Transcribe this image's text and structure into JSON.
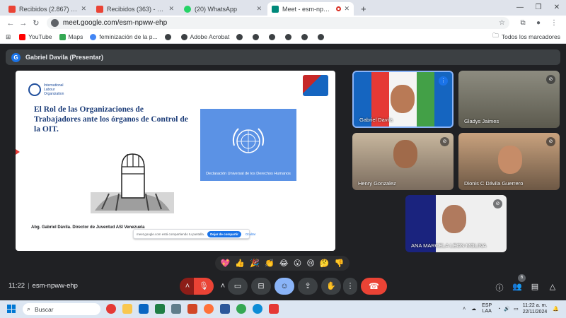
{
  "tabs": [
    {
      "title": "Recibidos (2.867) - marcelm03@",
      "favicon_color": "#ea4335"
    },
    {
      "title": "Recibidos (363) - centralsindicat",
      "favicon_color": "#ea4335"
    },
    {
      "title": "(20) WhatsApp",
      "favicon_color": "#25d366"
    },
    {
      "title": "Meet - esm-npww-ehp",
      "favicon_color": "#00897b"
    }
  ],
  "address_bar": {
    "url": "meet.google.com/esm-npww-ehp"
  },
  "bookmarks": {
    "items": [
      "YouTube",
      "Maps",
      "feminización de la p...",
      "Adobe Acrobat"
    ],
    "all_label": "Todos los marcadores"
  },
  "meet": {
    "presenter": {
      "initial": "G",
      "label": "Gabriel Davila (Presentar)"
    },
    "slide": {
      "logo_text": "International Labour Organization",
      "title": "El Rol de las Organizaciones de Trabajadores ante los órganos de Control de la OIT.",
      "un_caption": "Declaración Universal de los Derechos Humanos",
      "author": "Abg. Gabriel Dávila. Director de Juventud ASI Venezuela",
      "share_notice": "meet.google.com está compartiendo tu pantalla.",
      "stop_share": "Dejar de compartir",
      "hide": "Ocultar"
    },
    "participants": [
      {
        "name": "Gabriel Davila"
      },
      {
        "name": "Gladys Jaimes"
      },
      {
        "name": "Henry Gonzalez"
      },
      {
        "name": "Dionis C Dávila Guerrero"
      },
      {
        "name": "ANA MARCELA LEON MOLINA"
      }
    ],
    "reactions": [
      "💖",
      "👍",
      "🎉",
      "👏",
      "😂",
      "😮",
      "😢",
      "🤔",
      "👎"
    ],
    "controls": {
      "time": "11:22",
      "meeting_code": "esm-npww-ehp",
      "people_count": "6"
    }
  },
  "taskbar": {
    "search_placeholder": "Buscar",
    "lang": "ESP",
    "lang_region": "LAA",
    "clock_time": "11:22 a. m.",
    "clock_date": "22/11/2024"
  }
}
